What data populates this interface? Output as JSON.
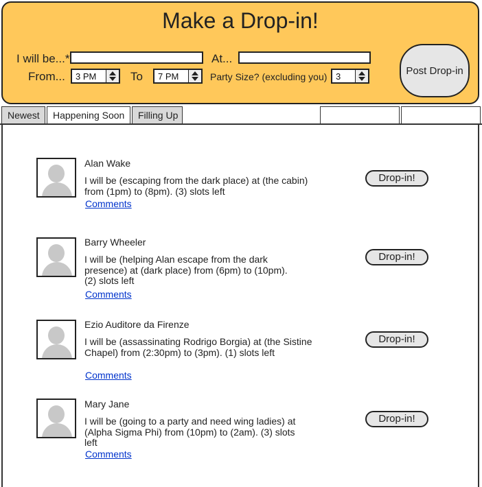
{
  "header": {
    "title": "Make a Drop-in!",
    "will_be_label": "I will be...*",
    "will_be_value": "",
    "at_label": "At...",
    "at_value": "",
    "from_label": "From...",
    "from_value": "3 PM",
    "to_label": "To",
    "to_value": "7 PM",
    "party_label": "Party Size? (excluding you)",
    "party_value": "3",
    "post_button": "Post Drop-in"
  },
  "tabs": [
    {
      "label": "Newest",
      "active": false
    },
    {
      "label": "Happening Soon",
      "active": true
    },
    {
      "label": "Filling Up",
      "active": false
    }
  ],
  "drop_button_label": "Drop-in!",
  "posts": [
    {
      "name": "Alan Wake",
      "text": "I will be (escaping from the dark place) at (the cabin) from (1pm) to (8pm). (3) slots left",
      "comments": "Comments"
    },
    {
      "name": "Barry Wheeler",
      "text": "I will be (helping Alan escape from the dark presence) at (dark place) from (6pm) to (10pm). (2) slots left",
      "comments": "Comments"
    },
    {
      "name": "Ezio Auditore da Firenze",
      "text": "I will be (assassinating Rodrigo Borgia) at (the Sistine Chapel) from (2:30pm) to (3pm). (1) slots left",
      "comments": "Comments"
    },
    {
      "name": "Mary Jane",
      "text": "I will be (going to a party and need wing ladies) at (Alpha Sigma Phi) from (10pm) to (2am). (3) slots left",
      "comments": "Comments"
    }
  ]
}
